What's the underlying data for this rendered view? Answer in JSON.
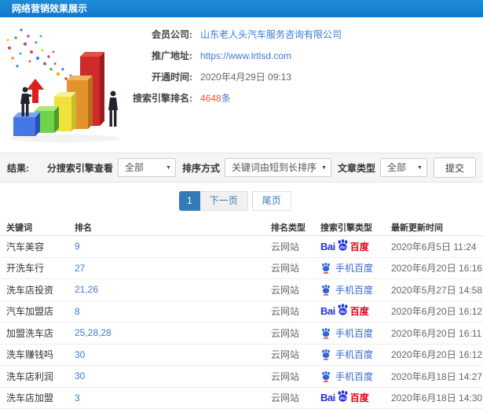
{
  "header": {
    "title": "网络营销效果展示"
  },
  "info": {
    "member_label": "会员公司:",
    "member_value": "山东老人头汽车服务咨询有限公司",
    "site_label": "推广地址:",
    "site_value": "https://www.lrtlsd.com",
    "open_label": "开通时间:",
    "open_value": "2020年4月29日 09:13",
    "rank_label": "搜索引擎排名:",
    "rank_count": "4648",
    "rank_unit": "条"
  },
  "filters": {
    "results_label": "结果:",
    "engine_filter_label": "分搜索引擎查看",
    "engine_filter_value": "全部",
    "sort_label": "排序方式",
    "sort_value": "关键词由短到长排序",
    "article_label": "文章类型",
    "article_value": "全部",
    "submit_label": "提交"
  },
  "pagination": {
    "current": "1",
    "next": "下一页",
    "last": "尾页"
  },
  "table": {
    "headers": [
      "关键词",
      "排名",
      "排名类型",
      "搜索引擎类型",
      "最新更新时间"
    ],
    "baidu_logo": {
      "bai": "Bai",
      "du": "du",
      "baidu": "百度"
    },
    "mobile_label": "手机百度",
    "rows": [
      {
        "keyword": "汽车美容",
        "rank": "9",
        "rank_type": "云网站",
        "engine": "baidu",
        "updated": "2020年6月5日 11:24"
      },
      {
        "keyword": "开洗车行",
        "rank": "27",
        "rank_type": "云网站",
        "engine": "mobile",
        "updated": "2020年6月20日 16:16"
      },
      {
        "keyword": "洗车店投资",
        "rank": "21,26",
        "rank_type": "云网站",
        "engine": "mobile",
        "updated": "2020年5月27日 14:58"
      },
      {
        "keyword": "汽车加盟店",
        "rank": "8",
        "rank_type": "云网站",
        "engine": "baidu",
        "updated": "2020年6月20日 16:12"
      },
      {
        "keyword": "加盟洗车店",
        "rank": "25,28,28",
        "rank_type": "云网站",
        "engine": "mobile",
        "updated": "2020年6月20日 16:11"
      },
      {
        "keyword": "洗车赚钱吗",
        "rank": "30",
        "rank_type": "云网站",
        "engine": "mobile",
        "updated": "2020年6月20日 16:12"
      },
      {
        "keyword": "洗车店利润",
        "rank": "30",
        "rank_type": "云网站",
        "engine": "mobile",
        "updated": "2020年6月18日 14:27"
      },
      {
        "keyword": "洗车店加盟",
        "rank": "3",
        "rank_type": "云网站",
        "engine": "baidu",
        "updated": "2020年6月18日 14:30"
      }
    ]
  },
  "colors": {
    "header_blue": "#1a82d2",
    "link_blue": "#3a7bd5",
    "count_orange": "#f4562a",
    "pagination_blue": "#337ab7",
    "baidu_blue": "#2632dd",
    "baidu_red": "#e60012",
    "mobile_blue": "#3a66d1"
  }
}
